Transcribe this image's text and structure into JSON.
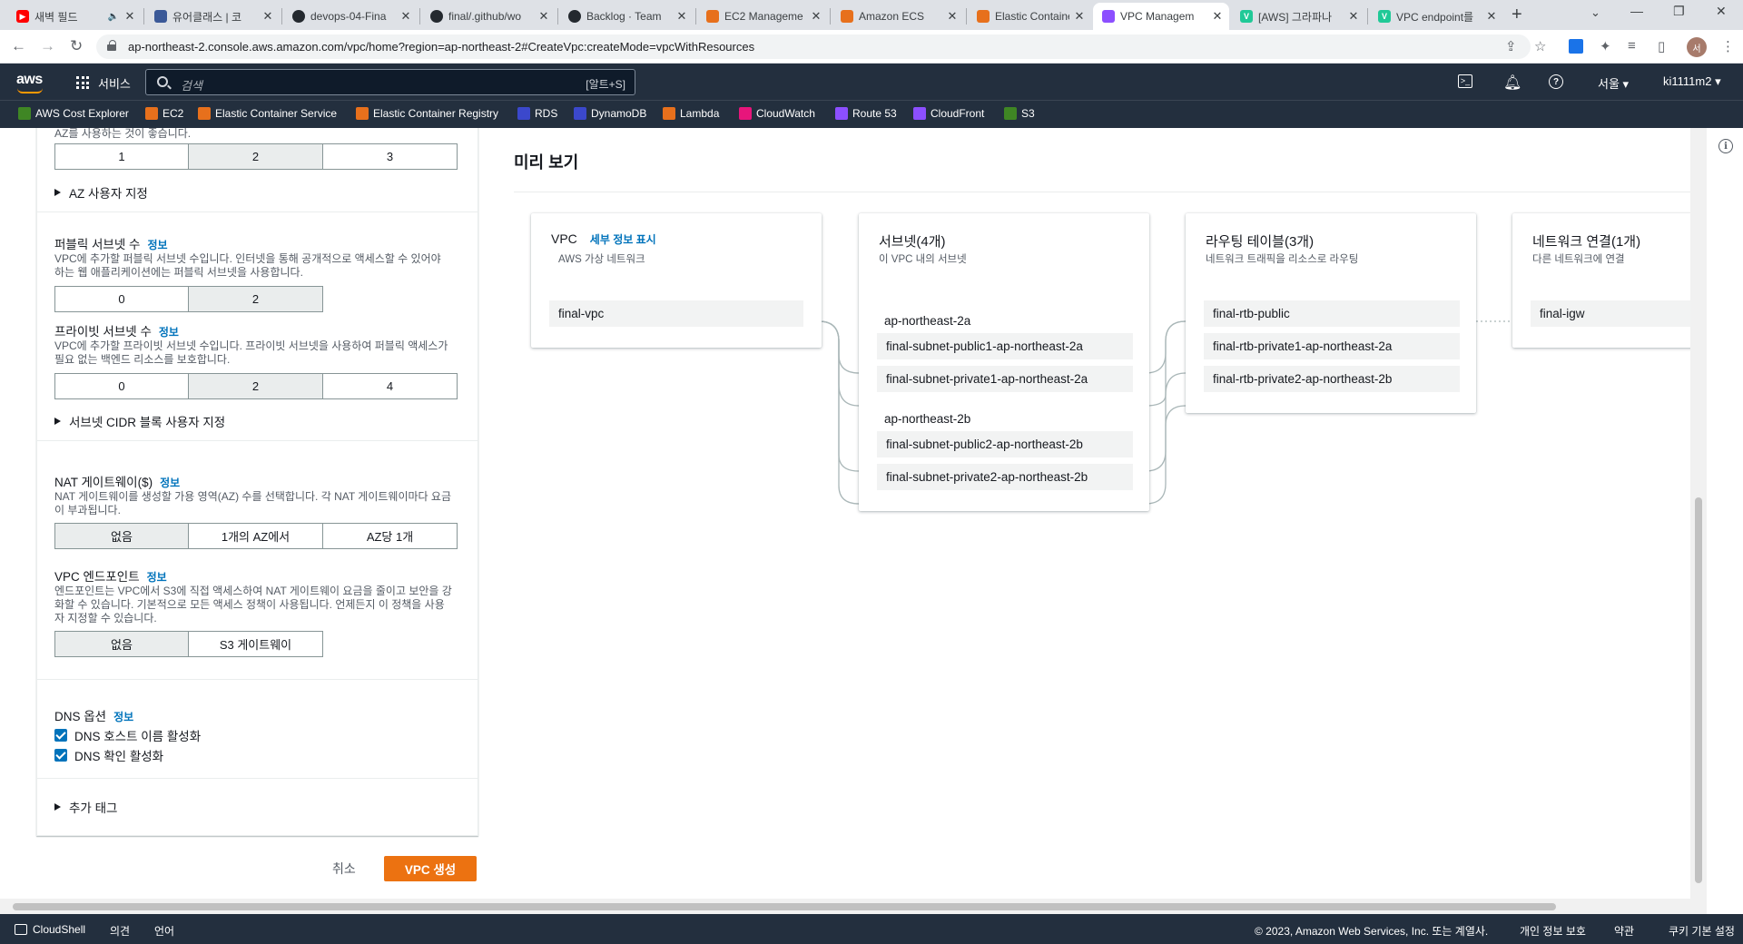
{
  "browser": {
    "tabs": [
      {
        "title": "새벽 필드",
        "color": "#ff0000"
      },
      {
        "title": "유어클래스 | 코",
        "color": "#3b5998"
      },
      {
        "title": "devops-04-Fina",
        "color": "#24292f"
      },
      {
        "title": "final/.github/wo",
        "color": "#24292f"
      },
      {
        "title": "Backlog · Team",
        "color": "#24292f"
      },
      {
        "title": "EC2 Manageme",
        "color": "#e7701c"
      },
      {
        "title": "Amazon ECS",
        "color": "#e7701c"
      },
      {
        "title": "Elastic Containe",
        "color": "#e7701c"
      },
      {
        "title": "VPC Managem",
        "color": "#8c4fff"
      },
      {
        "title": "[AWS] 그라파나",
        "color": "#20c997"
      },
      {
        "title": "VPC endpoint를",
        "color": "#20c997"
      }
    ],
    "active_tab": 8,
    "url": "ap-northeast-2.console.aws.amazon.com/vpc/home?region=ap-northeast-2#CreateVpc:createMode=vpcWithResources",
    "avatar_initial": "서"
  },
  "aws_nav": {
    "logo": "aws",
    "services": "서비스",
    "search_placeholder": "검색",
    "search_shortcut": "[알트+S]",
    "region": "서울 ▾",
    "account": "ki1111m2 ▾"
  },
  "bookmarks": [
    {
      "label": "AWS Cost Explorer",
      "color": "#3f8624"
    },
    {
      "label": "EC2",
      "color": "#e7701c"
    },
    {
      "label": "Elastic Container Service",
      "color": "#e7701c"
    },
    {
      "label": "Elastic Container Registry",
      "color": "#e7701c"
    },
    {
      "label": "RDS",
      "color": "#3b48cc"
    },
    {
      "label": "DynamoDB",
      "color": "#3b48cc"
    },
    {
      "label": "Lambda",
      "color": "#e7701c"
    },
    {
      "label": "CloudWatch",
      "color": "#e7157b"
    },
    {
      "label": "Route 53",
      "color": "#8c4fff"
    },
    {
      "label": "CloudFront",
      "color": "#8c4fff"
    },
    {
      "label": "S3",
      "color": "#3f8624"
    }
  ],
  "form": {
    "az_desc_tail": "AZ를 사용하는 것이 좋습니다.",
    "az_options": [
      "1",
      "2",
      "3"
    ],
    "az_custom": "AZ 사용자 지정",
    "public_label": "퍼블릭 서브넷 수",
    "public_desc": "VPC에 추가할 퍼블릭 서브넷 수입니다. 인터넷을 통해 공개적으로 액세스할 수 있어야 하는 웹 애플리케이션에는 퍼블릭 서브넷을 사용합니다.",
    "public_options": [
      "0",
      "2"
    ],
    "private_label": "프라이빗 서브넷 수",
    "private_desc": "VPC에 추가할 프라이빗 서브넷 수입니다. 프라이빗 서브넷을 사용하여 퍼블릭 액세스가 필요 없는 백엔드 리소스를 보호합니다.",
    "private_options": [
      "0",
      "2",
      "4"
    ],
    "cidr_custom": "서브넷 CIDR 블록 사용자 지정",
    "nat_label": "NAT 게이트웨이($)",
    "nat_desc": "NAT 게이트웨이를 생성할 가용 영역(AZ) 수를 선택합니다. 각 NAT 게이트웨이마다 요금이 부과됩니다.",
    "nat_options": [
      "없음",
      "1개의 AZ에서",
      "AZ당 1개"
    ],
    "endpoint_label": "VPC 엔드포인트",
    "endpoint_desc": "엔드포인트는 VPC에서 S3에 직접 액세스하여 NAT 게이트웨이 요금을 줄이고 보안을 강화할 수 있습니다. 기본적으로 모든 액세스 정책이 사용됩니다. 언제든지 이 정책을 사용자 지정할 수 있습니다.",
    "endpoint_options": [
      "없음",
      "S3 게이트웨이"
    ],
    "dns_label": "DNS 옵션",
    "dns_hostnames": "DNS 호스트 이름 활성화",
    "dns_resolution": "DNS 확인 활성화",
    "tags": "추가 태그",
    "info": "정보",
    "cancel": "취소",
    "create": "VPC 생성"
  },
  "preview": {
    "title": "미리 보기",
    "vpc": {
      "title": "VPC",
      "info": "세부 정보 표시",
      "sub": "AWS 가상 네트워크",
      "name": "final-vpc"
    },
    "subnets": {
      "title": "서브넷(4개)",
      "sub": "이 VPC 내의 서브넷",
      "az_a": "ap-northeast-2a",
      "az_b": "ap-northeast-2b",
      "items": [
        "final-subnet-public1-ap-northeast-2a",
        "final-subnet-private1-ap-northeast-2a",
        "final-subnet-public2-ap-northeast-2b",
        "final-subnet-private2-ap-northeast-2b"
      ]
    },
    "routes": {
      "title": "라우팅 테이블(3개)",
      "sub": "네트워크 트래픽을 리소스로 라우팅",
      "items": [
        "final-rtb-public",
        "final-rtb-private1-ap-northeast-2a",
        "final-rtb-private2-ap-northeast-2b"
      ]
    },
    "network": {
      "title": "네트워크 연결(1개)",
      "sub": "다른 네트워크에 연결",
      "item": "final-igw"
    }
  },
  "footer": {
    "cloudshell": "CloudShell",
    "feedback": "의견",
    "language": "언어",
    "copyright": "© 2023, Amazon Web Services, Inc. 또는 계열사.",
    "privacy": "개인 정보 보호",
    "terms": "약관",
    "cookies": "쿠키 기본 설정"
  }
}
